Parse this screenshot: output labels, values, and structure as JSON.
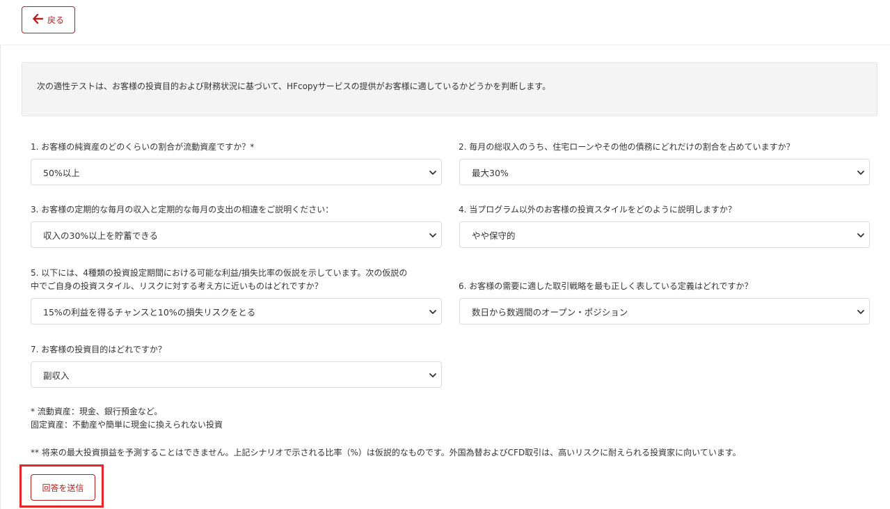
{
  "header": {
    "back_label": "戻る"
  },
  "intro_text": "次の適性テストは、お客様の投資目的および財務状況に基づいて、HFcopyサービスの提供がお客様に適しているかどうかを判断します。",
  "questions": [
    {
      "label": "1. お客様の純資産のどのくらいの割合が流動資産ですか？*",
      "selected": "50%以上"
    },
    {
      "label": "2. 毎月の総収入のうち、住宅ローンやその他の債務にどれだけの割合を占めていますか？",
      "selected": "最大30%"
    },
    {
      "label": "3. お客様の定期的な毎月の収入と定期的な毎月の支出の相違をご説明ください：",
      "selected": "収入の30%以上を貯蓄できる"
    },
    {
      "label": "4. 当プログラム以外のお客様の投資スタイルをどのように説明しますか？",
      "selected": "やや保守的"
    },
    {
      "label_line1": "5. 以下には、4種類の投資設定期間における可能な利益/損失比率の仮説を示しています。次の仮説の",
      "label_line2": "中でご自身の投資スタイル、リスクに対する考え方に近いものはどれですか？",
      "selected": "15%の利益を得るチャンスと10%の損失リスクをとる"
    },
    {
      "label": "6. お客様の需要に適した取引戦略を最も正しく表している定義はどれですか？",
      "selected": "数日から数週間のオープン・ポジション"
    },
    {
      "label": "7. お客様の投資目的はどれですか？",
      "selected": "副収入"
    }
  ],
  "notes": {
    "liquid": "* 流動資産：現金、銀行預金など。",
    "fixed": "固定資産：不動産や簡単に現金に換えられない投資",
    "disclaimer": "** 将来の最大投資損益を予測することはできません。上記シナリオで示される比率（%）は仮説的なものです。外国為替およびCFD取引は、高いリスクに耐えられる投資家に向いています。"
  },
  "submit_label": "回答を送信",
  "colors": {
    "accent": "#b71c1c",
    "highlight": "#e5252a"
  }
}
